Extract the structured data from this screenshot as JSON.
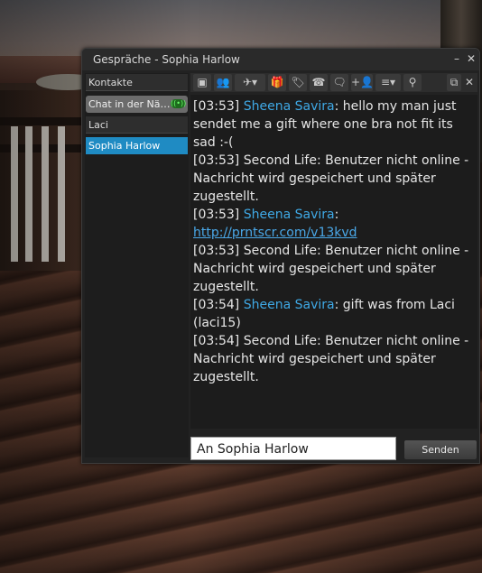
{
  "window": {
    "title": "Gespräche - Sophia Harlow"
  },
  "sidebar": {
    "items": [
      {
        "label": "Kontakte"
      },
      {
        "label": "Chat in der Nä…"
      },
      {
        "label": "Laci"
      },
      {
        "label": "Sophia Harlow"
      }
    ]
  },
  "toolbar": {
    "icons": [
      "profile-icon",
      "friends-icon",
      "teleport-icon",
      "gift-icon",
      "tag-icon",
      "call-icon",
      "voice-icon",
      "add-person-icon",
      "menu-icon",
      "search-icon",
      "popout-icon",
      "close-icon"
    ]
  },
  "chat": {
    "messages": [
      {
        "time": "[03:53]",
        "sender": "Sheena Savira",
        "text": ": hello my man just sendet me a gift where one bra not fit its sad :-("
      },
      {
        "time": "[03:53]",
        "sender": "",
        "text": "Second Life: Benutzer nicht online - Nachricht wird gespeichert und später zugestellt."
      },
      {
        "time": "[03:53]",
        "sender": "Sheena Savira",
        "text": ": ",
        "link": "http://prntscr.com/v13kvd"
      },
      {
        "time": "[03:53]",
        "sender": "",
        "text": "Second Life: Benutzer nicht online - Nachricht wird gespeichert und später zugestellt."
      },
      {
        "time": "[03:54]",
        "sender": "Sheena Savira",
        "text": ": gift was from Laci (laci15)"
      },
      {
        "time": "[03:54]",
        "sender": "",
        "text": "Second Life: Benutzer nicht online - Nachricht wird gespeichert und später zugestellt."
      }
    ]
  },
  "input": {
    "value": "An Sophia Harlow"
  },
  "send_button": {
    "label": "Senden"
  },
  "colors": {
    "accent": "#1f8bc3",
    "name": "#3fa9e6"
  }
}
